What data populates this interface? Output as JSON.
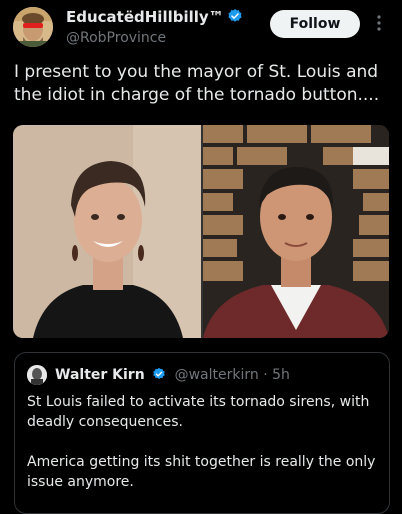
{
  "author": {
    "display_name": "EducatëdHillbilly™",
    "handle": "@RobProvince",
    "verified": true,
    "avatar_icon": "avatar-portrait-icon"
  },
  "actions": {
    "follow_label": "Follow",
    "more_icon": "more-vertical-icon"
  },
  "tweet": {
    "text": "I present to you the mayor of St. Louis and the idiot in charge of the tornado button...."
  },
  "media": {
    "count": 2
  },
  "quote": {
    "display_name": "Walter Kirn",
    "handle": "@walterkirn",
    "separator": "·",
    "time": "5h",
    "verified": true,
    "paragraph1": "St Louis failed to activate its tornado sirens, with deadly consequences.",
    "paragraph2": "America getting its shit together is really the only issue anymore."
  },
  "colors": {
    "background": "#000000",
    "text": "#e7e9ea",
    "secondary": "#71767b",
    "verified": "#1d9bf0",
    "border": "#2f3336"
  }
}
